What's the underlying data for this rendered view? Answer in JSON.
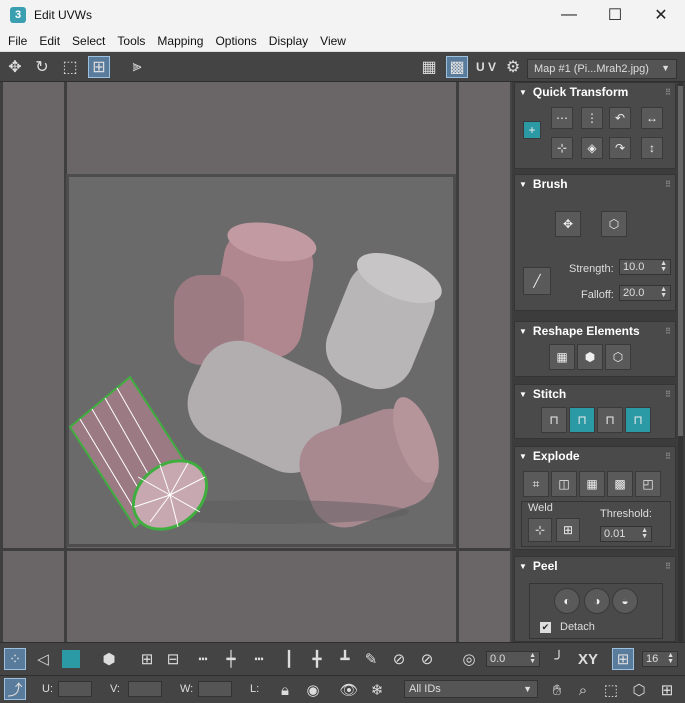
{
  "window": {
    "app_icon": "3",
    "title": "Edit UVWs",
    "minimize": "—",
    "maximize": "☐",
    "close": "✕"
  },
  "menu": [
    "File",
    "Edit",
    "Select",
    "Tools",
    "Mapping",
    "Options",
    "Display",
    "View"
  ],
  "toolbar": {
    "uv_label": "U V",
    "map_select": "Map #1 (Pi...Mrah2.jpg)"
  },
  "quick_transform": {
    "title": "Quick Transform"
  },
  "brush": {
    "title": "Brush",
    "strength_label": "Strength:",
    "strength_value": "10.0",
    "falloff_label": "Falloff:",
    "falloff_value": "20.0"
  },
  "reshape": {
    "title": "Reshape Elements"
  },
  "stitch": {
    "title": "Stitch"
  },
  "explode": {
    "title": "Explode",
    "weld_label": "Weld",
    "threshold_label": "Threshold:",
    "threshold_value": "0.01"
  },
  "peel": {
    "title": "Peel",
    "detach_label": "Detach",
    "detach_checked": true
  },
  "bottom_bar": {
    "rotate_value": "0.0",
    "xy_label": "XY",
    "grid_value": "16",
    "u_label": "U:",
    "v_label": "V:",
    "w_label": "W:",
    "l_label": "L:",
    "ids_select": "All IDs"
  },
  "colors": {
    "accent": "#2c9aa4",
    "selection_edge": "#3fae3f",
    "panel_bg": "#444444"
  }
}
